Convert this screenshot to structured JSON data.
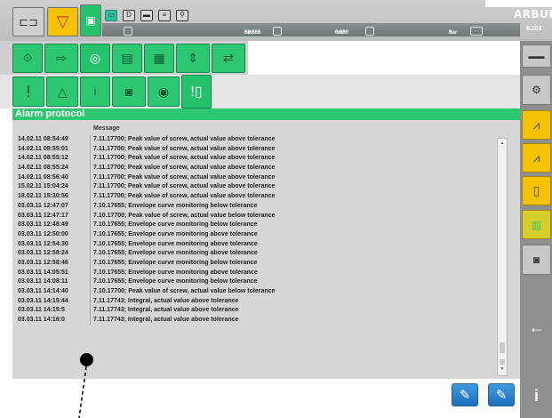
{
  "brand": {
    "text": "ARBURG"
  },
  "status": {
    "values": [
      "58.686",
      "0.000",
      "0"
    ],
    "units": [
      "cm³",
      "cm³",
      "bar"
    ],
    "right_value": "8.282"
  },
  "toolbar": {
    "row1": [
      "mode-icon",
      "funnel-icon",
      "single-cycle-icon"
    ],
    "row2": [
      "nozzle-forward-icon",
      "nozzle-back-icon",
      "screw-icon",
      "mould-open-icon",
      "calendar-icon",
      "ejector-icon",
      "transfer-icon"
    ],
    "row3": [
      "alarm-exclamation-icon",
      "warning-triangle-icon",
      "info-icon",
      "timer-square-icon",
      "timer-circle-icon",
      "alarm-protocol-icon"
    ]
  },
  "page": {
    "title": "Alarm protocol"
  },
  "table": {
    "column_header": "Message",
    "rows": [
      {
        "time": "14.02.11 08:54:49",
        "message": "7.11.17700; Peak value of screw, actual value above tolerance"
      },
      {
        "time": "14.02.11 08:55:01",
        "message": "7.11.17700; Peak value of screw, actual value above tolerance"
      },
      {
        "time": "14.02.11 08:55:12",
        "message": "7.11.17700; Peak value of screw, actual value above tolerance"
      },
      {
        "time": "14.02.11 08:55:24",
        "message": "7.11.17700; Peak value of screw, actual value above tolerance"
      },
      {
        "time": "14.02.11 08:56:40",
        "message": "7.11.17700; Peak value of screw, actual value above tolerance"
      },
      {
        "time": "15.02.11 15:04:24",
        "message": "7.11.17700; Peak value of screw, actual value above tolerance"
      },
      {
        "time": "18.02.11 15:30:56",
        "message": "7.11.17700; Peak value of screw, actual value above tolerance"
      },
      {
        "time": "03.03.11 12:47:07",
        "message": "7.10.17655; Envelope curve monitoring below tolerance"
      },
      {
        "time": "03.03.11 12:47:17",
        "message": "7.10.17700; Peak value of screw, actual value below tolerance"
      },
      {
        "time": "03.03.11 12:48:49",
        "message": "7.10.17655; Envelope curve monitoring below tolerance"
      },
      {
        "time": "03.03.11 12:50:00",
        "message": "7.10.17655; Envelope curve monitoring above tolerance"
      },
      {
        "time": "03.03.11 12:54:30",
        "message": "7.10.17655; Envelope curve monitoring above tolerance"
      },
      {
        "time": "03.03.11 12:58:24",
        "message": "7.10.17655; Envelope curve monitoring above tolerance"
      },
      {
        "time": "03.03.11 12:58:46",
        "message": "7.10.17655; Envelope curve monitoring below tolerance"
      },
      {
        "time": "03.03.11 14:05:51",
        "message": "7.10.17655; Envelope curve monitoring above tolerance"
      },
      {
        "time": "03.03.11 14:08:11",
        "message": "7.10.17655; Envelope curve monitoring below tolerance"
      },
      {
        "time": "03.03.11 14:14:40",
        "message": "7.10.17700; Peak value of screw, actual value below tolerance"
      },
      {
        "time": "03.03.11 14:15:44",
        "message": "7.11.17743; Integral, actual value above tolerance"
      },
      {
        "time": "03.03.11 14:15:5",
        "message": "7.11.17743; Integral, actual value above tolerance"
      },
      {
        "time": "03.03.11 14:16:0",
        "message": "7.11.17743; Integral, actual value above tolerance"
      }
    ]
  },
  "sidebar": {
    "items": [
      "toggle-icon",
      "dial-icon",
      "curve-icon",
      "curve-tolerance-icon",
      "document-icon",
      "barcode-icon",
      "comment-icon",
      "back-arrow-icon",
      "info-icon"
    ],
    "back_glyph": "←",
    "info_glyph": "i"
  },
  "bottom": {
    "edit_glyph": "✎"
  }
}
